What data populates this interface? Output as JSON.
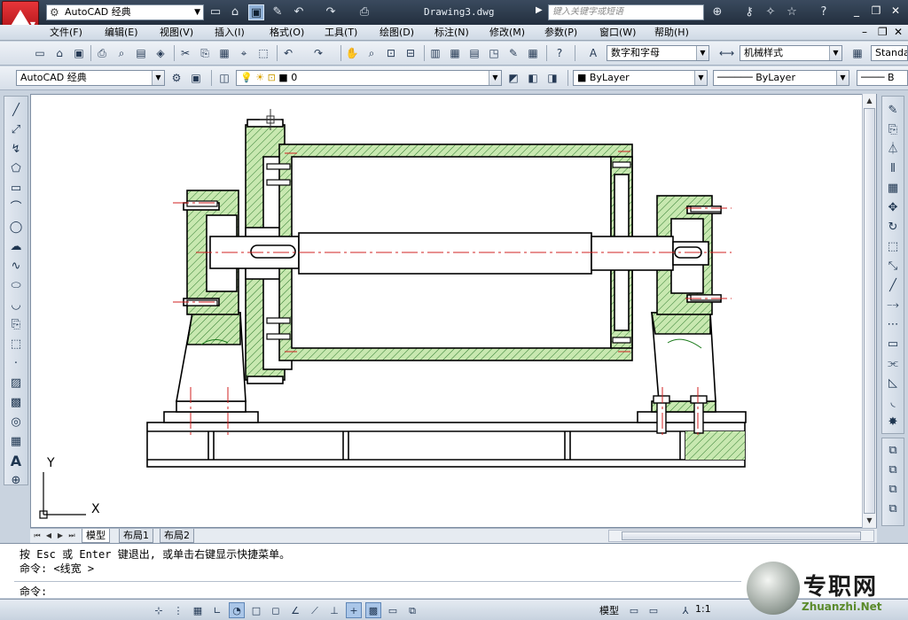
{
  "title_bar": {
    "workspace": "AutoCAD 经典",
    "document_title": "Drawing3.dwg",
    "search_placeholder": "键入关键字或短语"
  },
  "menu": {
    "items": [
      "文件(F)",
      "编辑(E)",
      "视图(V)",
      "插入(I)",
      "格式(O)",
      "工具(T)",
      "绘图(D)",
      "标注(N)",
      "修改(M)",
      "参数(P)",
      "窗口(W)",
      "帮助(H)"
    ]
  },
  "toolbar1": {
    "text_style": "数字和字母",
    "dim_style": "机械样式",
    "table_style": "Standa"
  },
  "toolbar2": {
    "workspace": "AutoCAD 经典",
    "layer": "0",
    "color": "ByLayer",
    "linetype": "ByLayer",
    "lineweight": "B"
  },
  "ucs": {
    "y_label": "Y",
    "x_label": "X"
  },
  "tabs": {
    "items": [
      "模型",
      "布局1",
      "布局2"
    ]
  },
  "command": {
    "line1": "按 Esc 或 Enter 键退出, 或单击右键显示快捷菜单。",
    "line2": "命令: <线宽 >",
    "prompt": "命令:"
  },
  "status": {
    "model_label": "模型",
    "scale": "1:1"
  },
  "watermark": {
    "cn": "专职网",
    "en": "Zhuanzhi.Net"
  },
  "colors": {
    "hatch": "#c8e8b0",
    "centerline": "#d02020",
    "outline": "#000000",
    "accent_curve": "#1a7a1a"
  }
}
